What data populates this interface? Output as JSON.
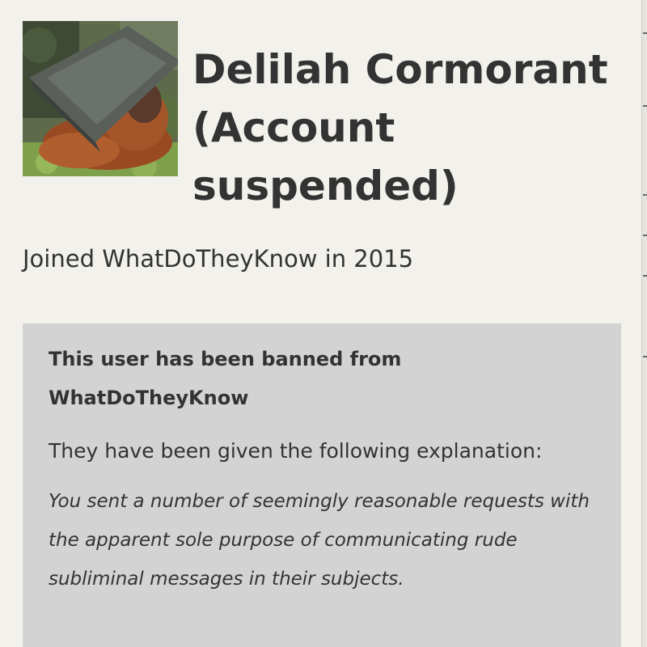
{
  "profile": {
    "name": "Delilah Cormorant (Account suspended)",
    "avatar_icon": "orangutan-photo",
    "joined": "Joined WhatDoTheyKnow in 2015"
  },
  "ban_notice": {
    "heading": "This user has been banned from WhatDoTheyKnow",
    "intro": "They have been given the following explanation:",
    "reason": "You sent a number of seemingly reasonable requests with the apparent sole purpose of communicating rude subliminal messages in their subjects."
  },
  "colors": {
    "page_background": "#f3f1ec",
    "notice_background": "#d3d3d3",
    "text": "#333333"
  }
}
